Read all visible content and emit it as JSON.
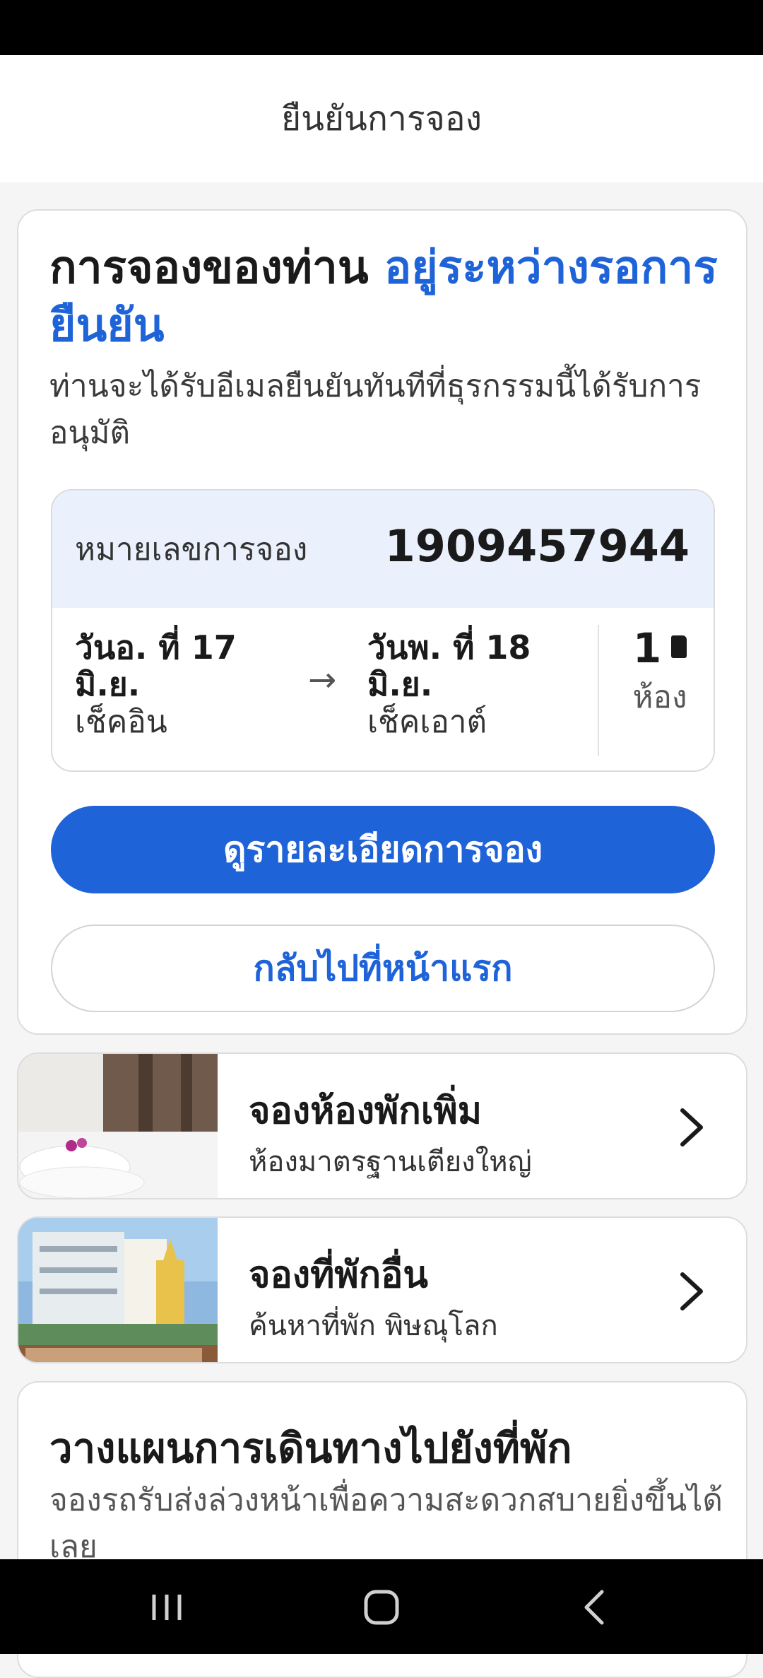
{
  "header": {
    "title": "ยืนยันการจอง"
  },
  "confirmation": {
    "headline_main": "การจองของท่าน ",
    "headline_accent": "อยู่ระหว่างรอการยืนยัน",
    "subtext": "ท่านจะได้รับอีเมลยืนยันทันทีที่ธุรกรรมนี้ได้รับการอนุมัติ",
    "booking_number_label": "หมายเลขการจอง",
    "booking_number": "1909457944",
    "checkin_date_line1": "วันอ. ที่ 17",
    "checkin_date_line2": "มิ.ย.",
    "checkin_label": "เช็คอิน",
    "checkout_date_line1": "วันพ. ที่ 18",
    "checkout_date_line2": "มิ.ย.",
    "checkout_label": "เช็คเอาต์",
    "arrow": "→",
    "rooms_count": "1",
    "rooms_unit": "ห้อง",
    "view_details_button": "ดูรายละเอียดการจอง",
    "back_home_button": "กลับไปที่หน้าแรก"
  },
  "promos": [
    {
      "title": "จองห้องพักเพิ่ม",
      "subtitle": "ห้องมาตรฐานเตียงใหญ่"
    },
    {
      "title": "จองที่พักอื่น",
      "subtitle": "ค้นหาที่พัก พิษณุโลก"
    }
  ],
  "plan": {
    "title": "วางแผนการเดินทางไปยังที่พัก",
    "subtitle": "จองรถรับส่งล่วงหน้าเพื่อความสะดวกสบายยิ่งขึ้นได้เลย"
  },
  "colors": {
    "accent": "#1f63d8",
    "info_bg": "#ebf1fc"
  },
  "icons": [
    "door-icon",
    "chevron-right-icon",
    "recent-apps-icon",
    "home-icon",
    "back-icon"
  ]
}
